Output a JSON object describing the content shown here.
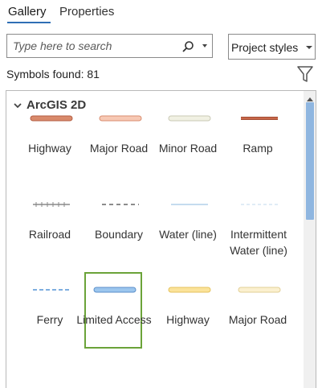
{
  "tabs": {
    "gallery": "Gallery",
    "properties": "Properties"
  },
  "search": {
    "placeholder": "Type here to search"
  },
  "styles_dropdown": {
    "value": "Project styles"
  },
  "symbols_found": "Symbols found: 81",
  "group": {
    "title": "ArcGIS 2D"
  },
  "symbols": [
    {
      "label": "Highway",
      "stroke": "#d98a6b",
      "edge": "#b45f44",
      "kind": "thick"
    },
    {
      "label": "Major Road",
      "stroke": "#f7c9b4",
      "edge": "#d98d70",
      "kind": "thick"
    },
    {
      "label": "Minor Road",
      "stroke": "#f1f1e3",
      "edge": "#c9c9b6",
      "kind": "thick"
    },
    {
      "label": "Ramp",
      "stroke": "#c8674a",
      "edge": "#a44d33",
      "kind": "flat"
    },
    {
      "label": "Railroad",
      "stroke": "#8a8a8a",
      "edge": "#8a8a8a",
      "kind": "rail"
    },
    {
      "label": "Boundary",
      "stroke": "#8c8c8c",
      "edge": "#8c8c8c",
      "kind": "dash"
    },
    {
      "label": "Water (line)",
      "stroke": "#c5dcef",
      "edge": "#c5dcef",
      "kind": "thin"
    },
    {
      "label": "Intermittent Water (line)",
      "stroke": "#d6e6f3",
      "edge": "#d6e6f3",
      "kind": "dashthin"
    },
    {
      "label": "Ferry",
      "stroke": "#7eaee0",
      "edge": "#7eaee0",
      "kind": "dashblue"
    },
    {
      "label": "Limited Access",
      "stroke": "#9cc6ee",
      "edge": "#5b8fc9",
      "kind": "thick",
      "selected": true
    },
    {
      "label": "Highway",
      "stroke": "#fbe39a",
      "edge": "#e5c25c",
      "kind": "thick"
    },
    {
      "label": "Major Road",
      "stroke": "#fbf0cf",
      "edge": "#e2cf96",
      "kind": "thick"
    }
  ]
}
